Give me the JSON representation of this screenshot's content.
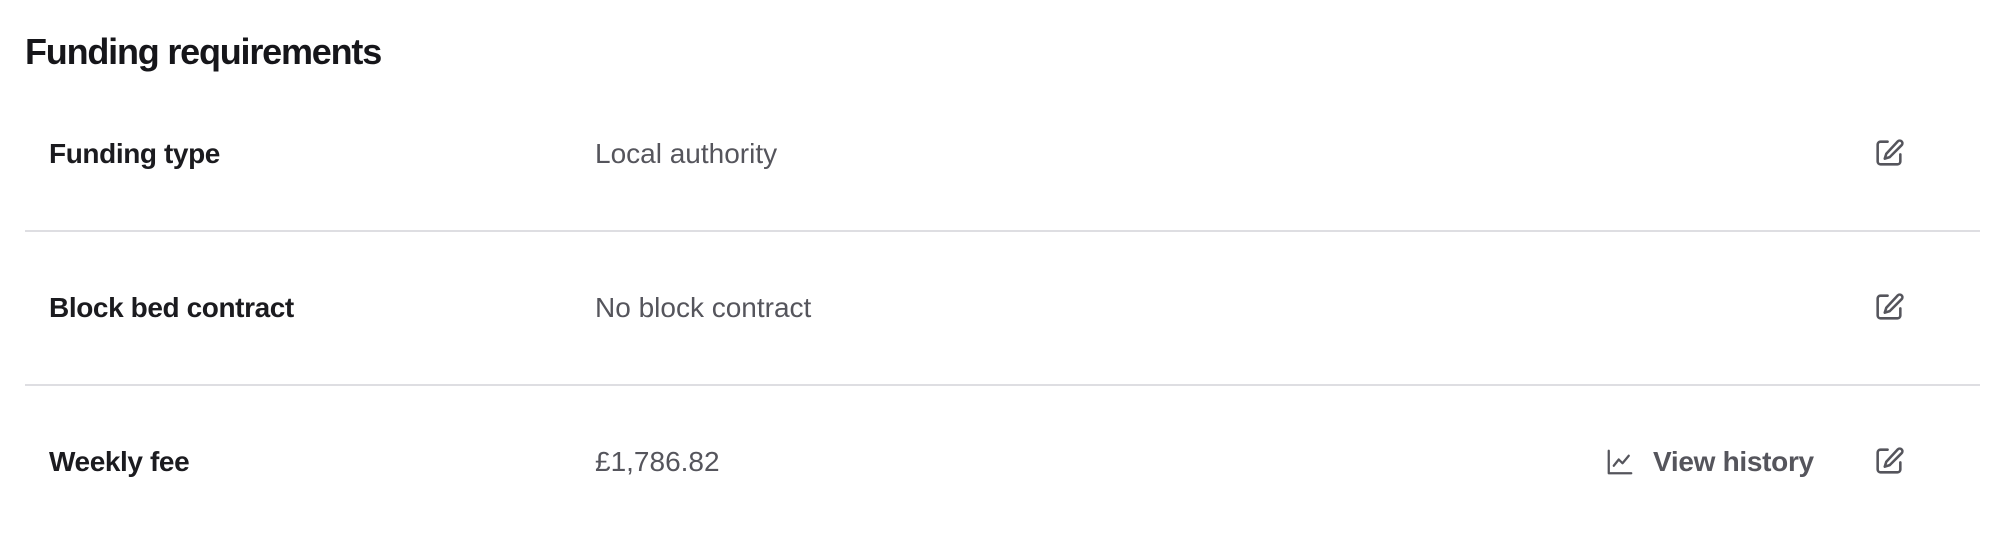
{
  "section": {
    "title": "Funding requirements"
  },
  "rows": [
    {
      "label": "Funding type",
      "value": "Local authority",
      "edit_icon": "edit-icon"
    },
    {
      "label": "Block bed contract",
      "value": "No block contract",
      "edit_icon": "edit-icon"
    },
    {
      "label": "Weekly fee",
      "value": "£1,786.82",
      "edit_icon": "edit-icon",
      "history": {
        "label": "View history",
        "icon": "line-chart-icon"
      }
    }
  ],
  "colors": {
    "text_primary": "#1b1b1f",
    "text_secondary": "#55555c",
    "divider": "#dedee2",
    "background": "#ffffff"
  }
}
